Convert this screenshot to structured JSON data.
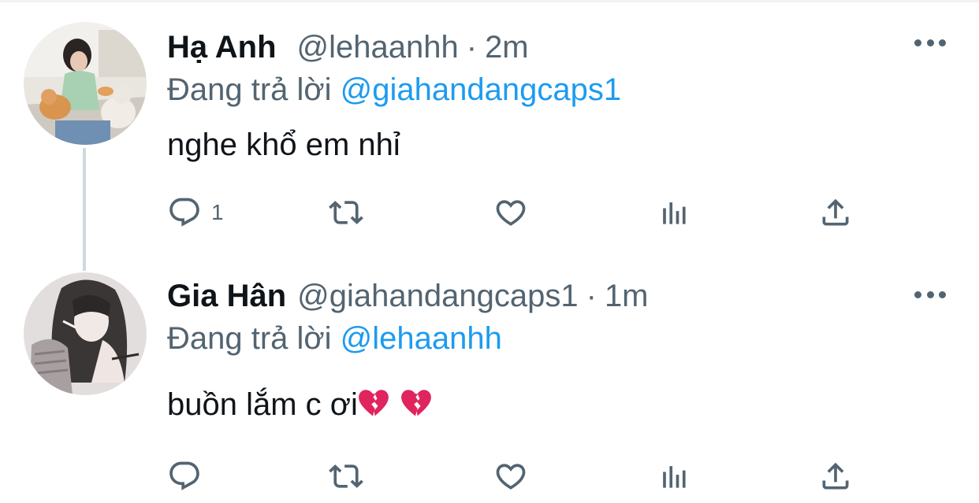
{
  "tweets": [
    {
      "name": "Hạ Anh",
      "handle": "@lehaanhh",
      "separator": "·",
      "time": "2m",
      "replying_prefix": "Đang trả lời",
      "replying_to": "@giahandangcaps1",
      "text": "nghe khổ em nhỉ",
      "reply_count": "1",
      "avatar_icon": "avatar-photo-girl-with-cats"
    },
    {
      "name": "Gia Hân",
      "handle": "@giahandangcaps1",
      "separator": "·",
      "time": "1m",
      "replying_prefix": "Đang trả lời",
      "replying_to": "@lehaanhh",
      "text": "buồn lắm c ơi",
      "text_emojis": [
        "broken-heart",
        "broken-heart"
      ],
      "reply_count": "",
      "avatar_icon": "avatar-illustration-girl"
    }
  ],
  "action_icons": [
    "reply-icon",
    "retweet-icon",
    "like-icon",
    "analytics-icon",
    "share-icon"
  ],
  "colors": {
    "text_primary": "#0f1419",
    "text_secondary": "#536471",
    "mention": "#1d9bf0",
    "thread_line": "#cfd9de",
    "broken_heart": "#e0245e"
  }
}
